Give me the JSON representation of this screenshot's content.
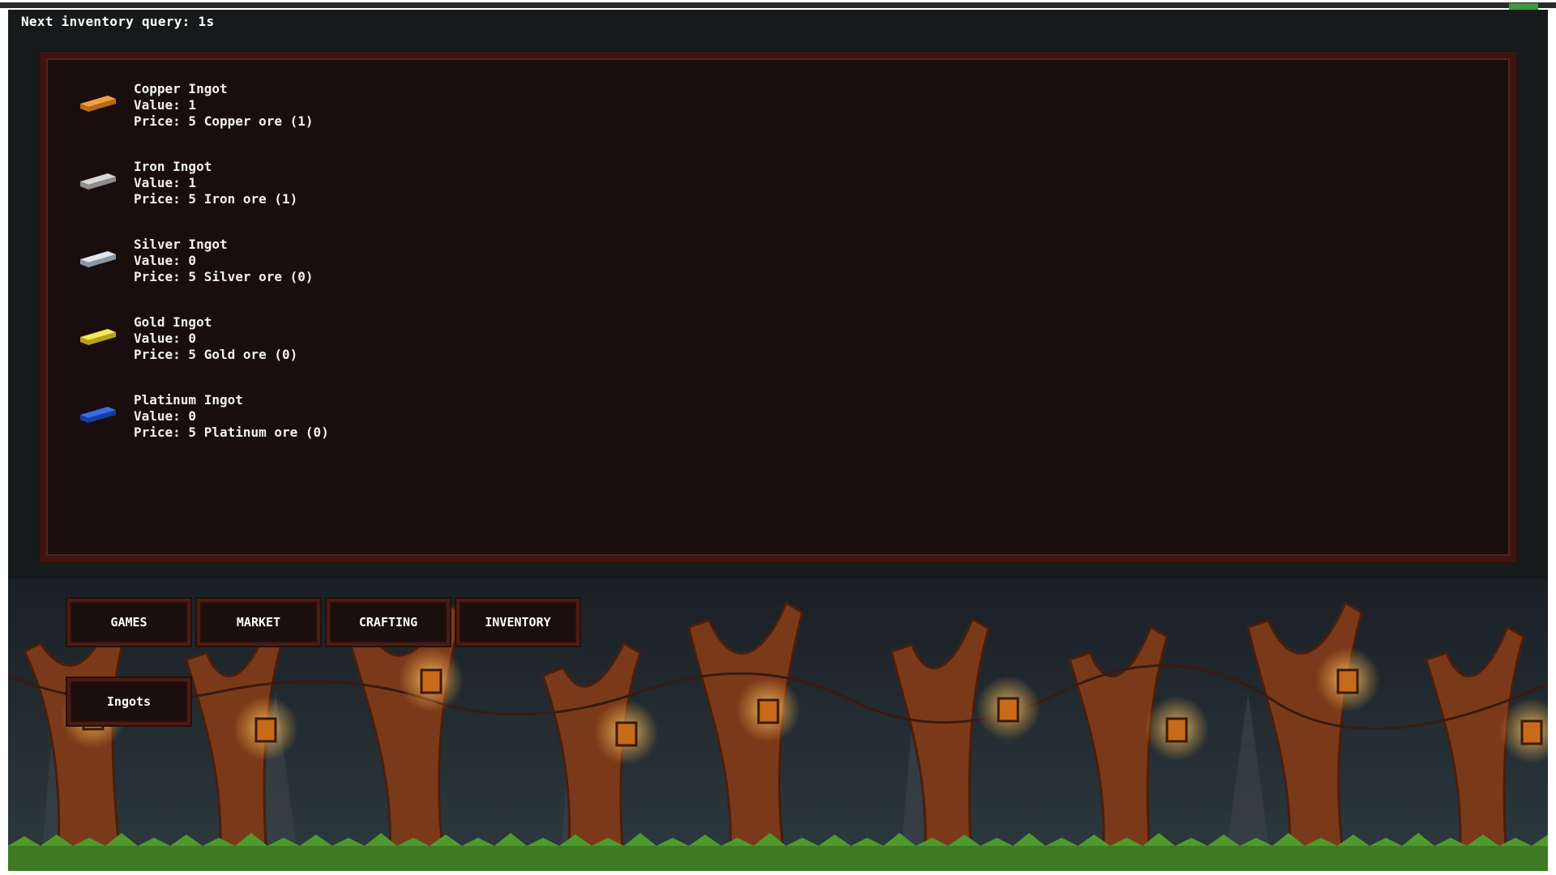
{
  "timer": {
    "text": "Next inventory query: 1s"
  },
  "items": [
    {
      "name": "Copper Ingot",
      "value": "Value: 1",
      "price": "Price: 5 Copper ore (1)",
      "icon": "copper-ingot-icon",
      "color": "#f0a040",
      "dark": "#b86a18"
    },
    {
      "name": "Iron Ingot",
      "value": "Value: 1",
      "price": "Price: 5 Iron ore (1)",
      "icon": "iron-ingot-icon",
      "color": "#d8d8d8",
      "dark": "#8c8c8c"
    },
    {
      "name": "Silver Ingot",
      "value": "Value: 0",
      "price": "Price: 5 Silver ore (0)",
      "icon": "silver-ingot-icon",
      "color": "#dfe6ee",
      "dark": "#8a96a4"
    },
    {
      "name": "Gold Ingot",
      "value": "Value: 0",
      "price": "Price: 5 Gold ore (0)",
      "icon": "gold-ingot-icon",
      "color": "#f5e65a",
      "dark": "#b8a020"
    },
    {
      "name": "Platinum Ingot",
      "value": "Value: 0",
      "price": "Price: 5 Platinum ore (0)",
      "icon": "platinum-ingot-icon",
      "color": "#3a6cf0",
      "dark": "#1c3aa0"
    }
  ],
  "nav": {
    "games": "GAMES",
    "market": "MARKET",
    "crafting": "CRAFTING",
    "inventory": "INVENTORY"
  },
  "sub_nav": {
    "ingots": "Ingots"
  }
}
